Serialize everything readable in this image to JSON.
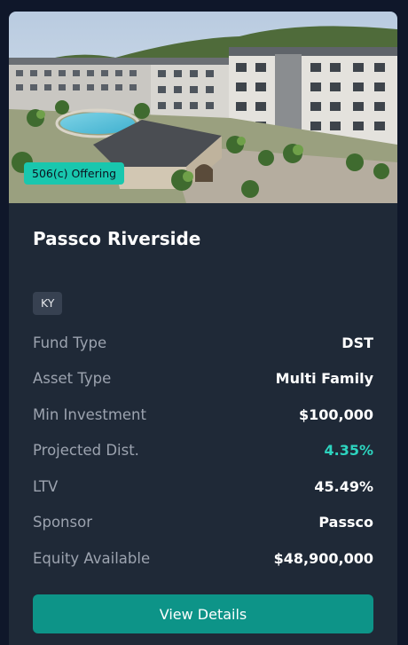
{
  "listing": {
    "badge": "506(c) Offering",
    "title": "Passco Riverside",
    "state_tag": "KY",
    "details": [
      {
        "label": "Fund Type",
        "value": "DST"
      },
      {
        "label": "Asset Type",
        "value": "Multi Family"
      },
      {
        "label": "Min Investment",
        "value": "$100,000"
      },
      {
        "label": "Projected Dist.",
        "value": "4.35%"
      },
      {
        "label": "LTV",
        "value": "45.49%"
      },
      {
        "label": "Sponsor",
        "value": "Passco"
      },
      {
        "label": "Equity Available",
        "value": "$48,900,000"
      }
    ],
    "cta_label": "View Details"
  },
  "colors": {
    "card_bg": "#1f2937",
    "accent_teal": "#19c7ae",
    "button_bg": "#0d9488",
    "highlight_value": "#2dd4bf"
  }
}
